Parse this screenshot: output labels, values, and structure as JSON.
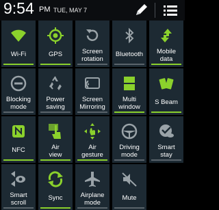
{
  "status_bar": {
    "time": "9:54",
    "ampm": "PM",
    "date": "TUE, MAY 7",
    "edit_icon": "pencil-icon",
    "menu_icon": "list-icon"
  },
  "colors": {
    "on_green": "#8bd12c",
    "off_gray": "#9aa3a8",
    "tile_bg": "#1d2a33"
  },
  "tiles": [
    {
      "id": "wifi",
      "label": "Wi-Fi",
      "on": true,
      "icon": "wifi-icon"
    },
    {
      "id": "gps",
      "label": "GPS",
      "on": true,
      "icon": "gps-icon"
    },
    {
      "id": "screen-rotation",
      "label": "Screen rotation",
      "on": false,
      "icon": "rotation-icon"
    },
    {
      "id": "bluetooth",
      "label": "Bluetooth",
      "on": false,
      "icon": "bluetooth-icon"
    },
    {
      "id": "mobile-data",
      "label": "Mobile data",
      "on": true,
      "icon": "mobile-data-icon"
    },
    {
      "id": "blocking-mode",
      "label": "Blocking mode",
      "on": false,
      "icon": "blocking-icon"
    },
    {
      "id": "power-saving",
      "label": "Power saving",
      "on": false,
      "icon": "recycle-icon"
    },
    {
      "id": "screen-mirroring",
      "label": "Screen Mirroring",
      "on": false,
      "icon": "screen-mirroring-icon"
    },
    {
      "id": "multi-window",
      "label": "Multi window",
      "on": true,
      "icon": "multi-window-icon"
    },
    {
      "id": "s-beam",
      "label": "S Beam",
      "on": true,
      "icon": "s-beam-icon"
    },
    {
      "id": "nfc",
      "label": "NFC",
      "on": true,
      "icon": "nfc-icon"
    },
    {
      "id": "air-view",
      "label": "Air view",
      "on": true,
      "icon": "air-view-icon"
    },
    {
      "id": "air-gesture",
      "label": "Air gesture",
      "on": true,
      "icon": "air-gesture-icon"
    },
    {
      "id": "driving-mode",
      "label": "Driving mode",
      "on": false,
      "icon": "steering-wheel-icon"
    },
    {
      "id": "smart-stay",
      "label": "Smart stay",
      "on": false,
      "icon": "smart-stay-icon"
    },
    {
      "id": "smart-scroll",
      "label": "Smart scroll",
      "on": false,
      "icon": "smart-scroll-icon"
    },
    {
      "id": "sync",
      "label": "Sync",
      "on": true,
      "icon": "sync-icon"
    },
    {
      "id": "airplane-mode",
      "label": "Airplane mode",
      "on": false,
      "icon": "airplane-icon"
    },
    {
      "id": "mute",
      "label": "Mute",
      "on": false,
      "icon": "mute-icon"
    }
  ]
}
